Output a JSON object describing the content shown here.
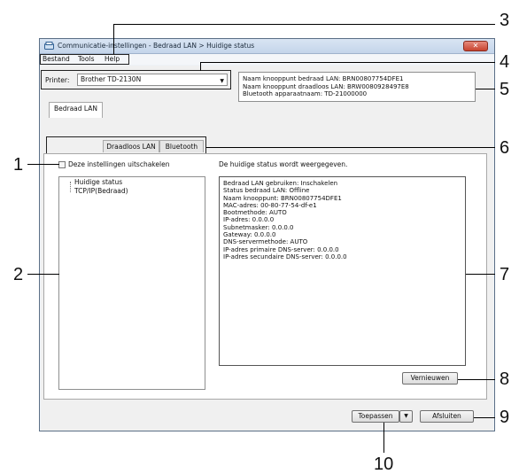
{
  "window": {
    "title": "Communicatie-instellingen - Bedraad LAN > Huidige status",
    "close_label": "✕"
  },
  "menu": {
    "items": [
      "Bestand",
      "Tools",
      "Help"
    ]
  },
  "printer": {
    "label": "Printer:",
    "selected": "Brother TD-2130N"
  },
  "node_info": [
    "Naam knooppunt bedraad LAN: BRN00807754DFE1",
    "Naam knooppunt draadloos LAN: BRW0080928497E8",
    "Bluetooth apparaatnaam: TD-21000000"
  ],
  "tabs": [
    "Bedraad LAN",
    "Draadloos LAN",
    "Bluetooth"
  ],
  "disable_checkbox_label": "Deze instellingen uitschakelen",
  "tree": {
    "items": [
      "Huidige status",
      "TCP/IP(Bedraad)"
    ]
  },
  "status_heading": "De huidige status wordt weergegeven.",
  "status_lines": [
    "Bedraad LAN gebruiken: Inschakelen",
    "Status bedraad LAN: Offline",
    "Naam knooppunt: BRN00807754DFE1",
    "MAC-adres: 00-80-77-54-df-e1",
    "Bootmethode: AUTO",
    "IP-adres: 0.0.0.0",
    "Subnetmasker: 0.0.0.0",
    "Gateway: 0.0.0.0",
    "DNS-servermethode: AUTO",
    "IP-adres primaire DNS-server: 0.0.0.0",
    "IP-adres secundaire DNS-server: 0.0.0.0"
  ],
  "buttons": {
    "refresh": "Vernieuwen",
    "apply": "Toepassen",
    "close": "Afsluiten"
  },
  "callouts": [
    "1",
    "2",
    "3",
    "4",
    "5",
    "6",
    "7",
    "8",
    "9",
    "10"
  ]
}
